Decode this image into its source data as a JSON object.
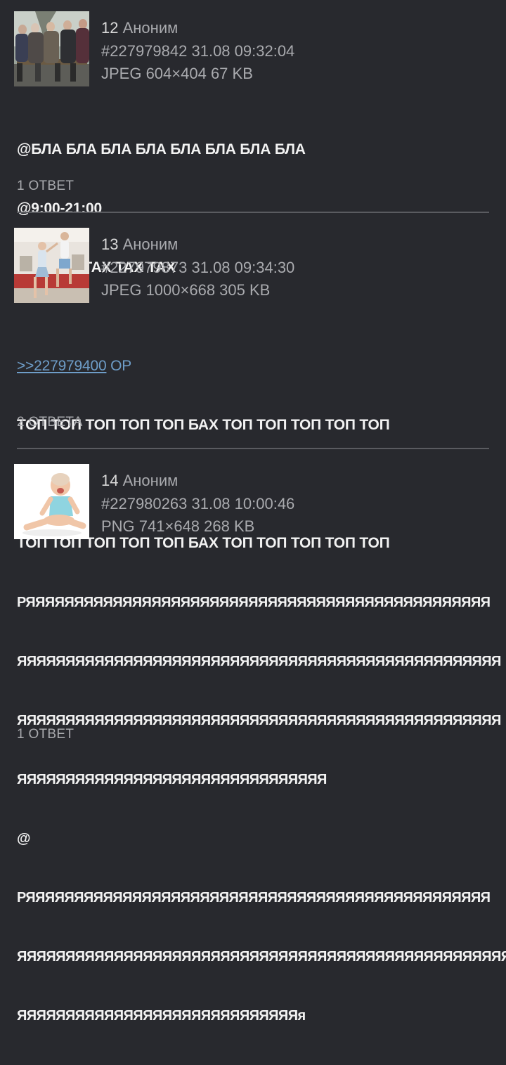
{
  "posts": [
    {
      "number": "12",
      "author": "Аноним",
      "post_id": "#227979842",
      "datetime": "31.08 09:32:04",
      "file_info": "JPEG 604×404 67 KB",
      "thumbnail_icon": "photo-elderly-people-on-bench",
      "lines": [
        "@БЛА БЛА БЛА БЛА БЛА БЛА БЛА БЛА",
        "@9:00-21:00",
        "@КУДАХ ТАХ ТАХ ТАХ"
      ],
      "replies": "1 ОТВЕТ"
    },
    {
      "number": "13",
      "author": "Аноним",
      "post_id": "#227979873",
      "datetime": "31.08 09:34:30",
      "file_info": "JPEG 1000×668 305 KB",
      "thumbnail_icon": "photo-children-jumping",
      "reply_link": ">>227979400",
      "reply_tag": "OP",
      "lines": [
        "ТОП ТОП ТОП ТОП ТОП БАХ ТОП ТОП ТОП ТОП ТОП",
        "@",
        "ТОП ТОП ТОП ТОП ТОП БАХ ТОП ТОП ТОП ТОП ТОП"
      ],
      "replies": "2 ОТВЕТА"
    },
    {
      "number": "14",
      "author": "Аноним",
      "post_id": "#227980263",
      "datetime": "31.08 10:00:46",
      "file_info": "PNG 741×648 268 KB",
      "thumbnail_icon": "photo-crying-baby",
      "lines": [
        "РЯЯЯЯЯЯЯЯЯЯЯЯЯЯЯЯЯЯЯЯЯЯЯЯЯЯЯЯЯЯЯЯЯЯЯЯЯЯЯЯЯЯЯЯЯЯЯЯ",
        "ЯЯЯЯЯЯЯЯЯЯЯЯЯЯЯЯЯЯЯЯЯЯЯЯЯЯЯЯЯЯЯЯЯЯЯЯЯЯЯЯЯЯЯЯЯЯЯЯЯЯ",
        "ЯЯЯЯЯЯЯЯЯЯЯЯЯЯЯЯЯЯЯЯЯЯЯЯЯЯЯЯЯЯЯЯЯЯЯЯЯЯЯЯЯЯЯЯЯЯЯЯЯЯ",
        "ЯЯЯЯЯЯЯЯЯЯЯЯЯЯЯЯЯЯЯЯЯЯЯЯЯЯЯЯЯЯЯЯ",
        "@",
        "РЯЯЯЯЯЯЯЯЯЯЯЯЯЯЯЯЯЯЯЯЯЯЯЯЯЯЯЯЯЯЯЯЯЯЯЯЯЯЯЯЯЯЯЯЯЯЯЯ",
        "ЯЯЯЯЯЯЯЯЯЯЯЯЯЯЯЯЯЯЯЯЯЯЯЯЯЯЯЯЯЯЯЯЯЯЯЯЯЯЯЯЯЯЯЯЯЯЯЯЯЯЯ",
        "ЯЯЯЯЯЯЯЯЯЯЯЯЯЯЯЯЯЯЯЯЯЯЯЯЯЯЯЯЯя"
      ],
      "replies": "1 ОТВЕТ"
    }
  ],
  "colors": {
    "background": "#28292e",
    "meta_text": "#a9aaae",
    "body_text": "#f2f2f2",
    "link": "#6e9dc8",
    "divider": "#5a5b60"
  }
}
